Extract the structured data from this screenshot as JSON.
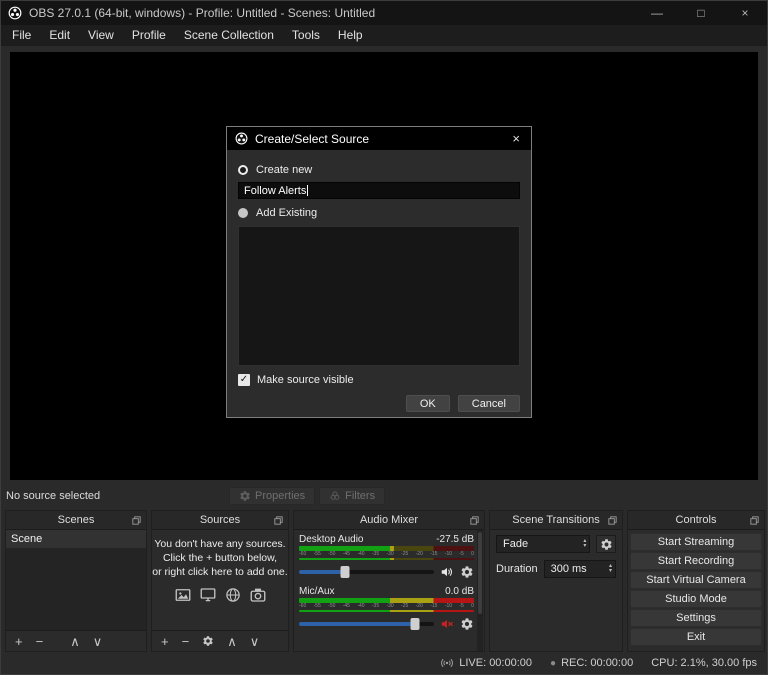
{
  "window": {
    "title": "OBS 27.0.1 (64-bit, windows) - Profile: Untitled - Scenes: Untitled",
    "minimize": "—",
    "maximize": "□",
    "close": "×"
  },
  "menu": {
    "items": [
      "File",
      "Edit",
      "View",
      "Profile",
      "Scene Collection",
      "Tools",
      "Help"
    ]
  },
  "dialog": {
    "title": "Create/Select Source",
    "close": "×",
    "create_new": "Create new",
    "name_value": "Follow Alerts",
    "add_existing": "Add Existing",
    "make_visible": "Make source visible",
    "ok": "OK",
    "cancel": "Cancel"
  },
  "source_toolbar": {
    "status": "No source selected",
    "properties": "Properties",
    "filters": "Filters"
  },
  "docks": {
    "scenes": {
      "title": "Scenes",
      "items": [
        "Scene"
      ]
    },
    "sources": {
      "title": "Sources",
      "empty_lines": [
        "You don't have any sources.",
        "Click the + button below,",
        "or right click here to add one."
      ]
    },
    "audio_mixer": {
      "title": "Audio Mixer",
      "ticks": [
        "-60",
        "-55",
        "-50",
        "-45",
        "-40",
        "-35",
        "-30",
        "-25",
        "-20",
        "-15",
        "-10",
        "-5",
        "0"
      ],
      "channels": [
        {
          "name": "Desktop Audio",
          "db": "-27.5 dB"
        },
        {
          "name": "Mic/Aux",
          "db": "0.0 dB"
        }
      ]
    },
    "transitions": {
      "title": "Scene Transitions",
      "selected": "Fade",
      "duration_label": "Duration",
      "duration_value": "300 ms"
    },
    "controls": {
      "title": "Controls",
      "buttons": [
        "Start Streaming",
        "Start Recording",
        "Start Virtual Camera",
        "Studio Mode",
        "Settings",
        "Exit"
      ]
    }
  },
  "statusbar": {
    "live": "LIVE: 00:00:00",
    "rec": "REC: 00:00:00",
    "cpu": "CPU: 2.1%, 30.00 fps"
  },
  "icons": {
    "add": "+",
    "remove": "−",
    "up": "∧",
    "down": "∨",
    "spin_up": "▴",
    "spin_down": "▾",
    "check": "✓",
    "dot": "●"
  },
  "colors": {
    "accent_blue": "#2d62a8",
    "mute_red": "#c42222",
    "meter_green": "#12a112",
    "meter_yellow": "#a8a112",
    "meter_red": "#b51515"
  }
}
